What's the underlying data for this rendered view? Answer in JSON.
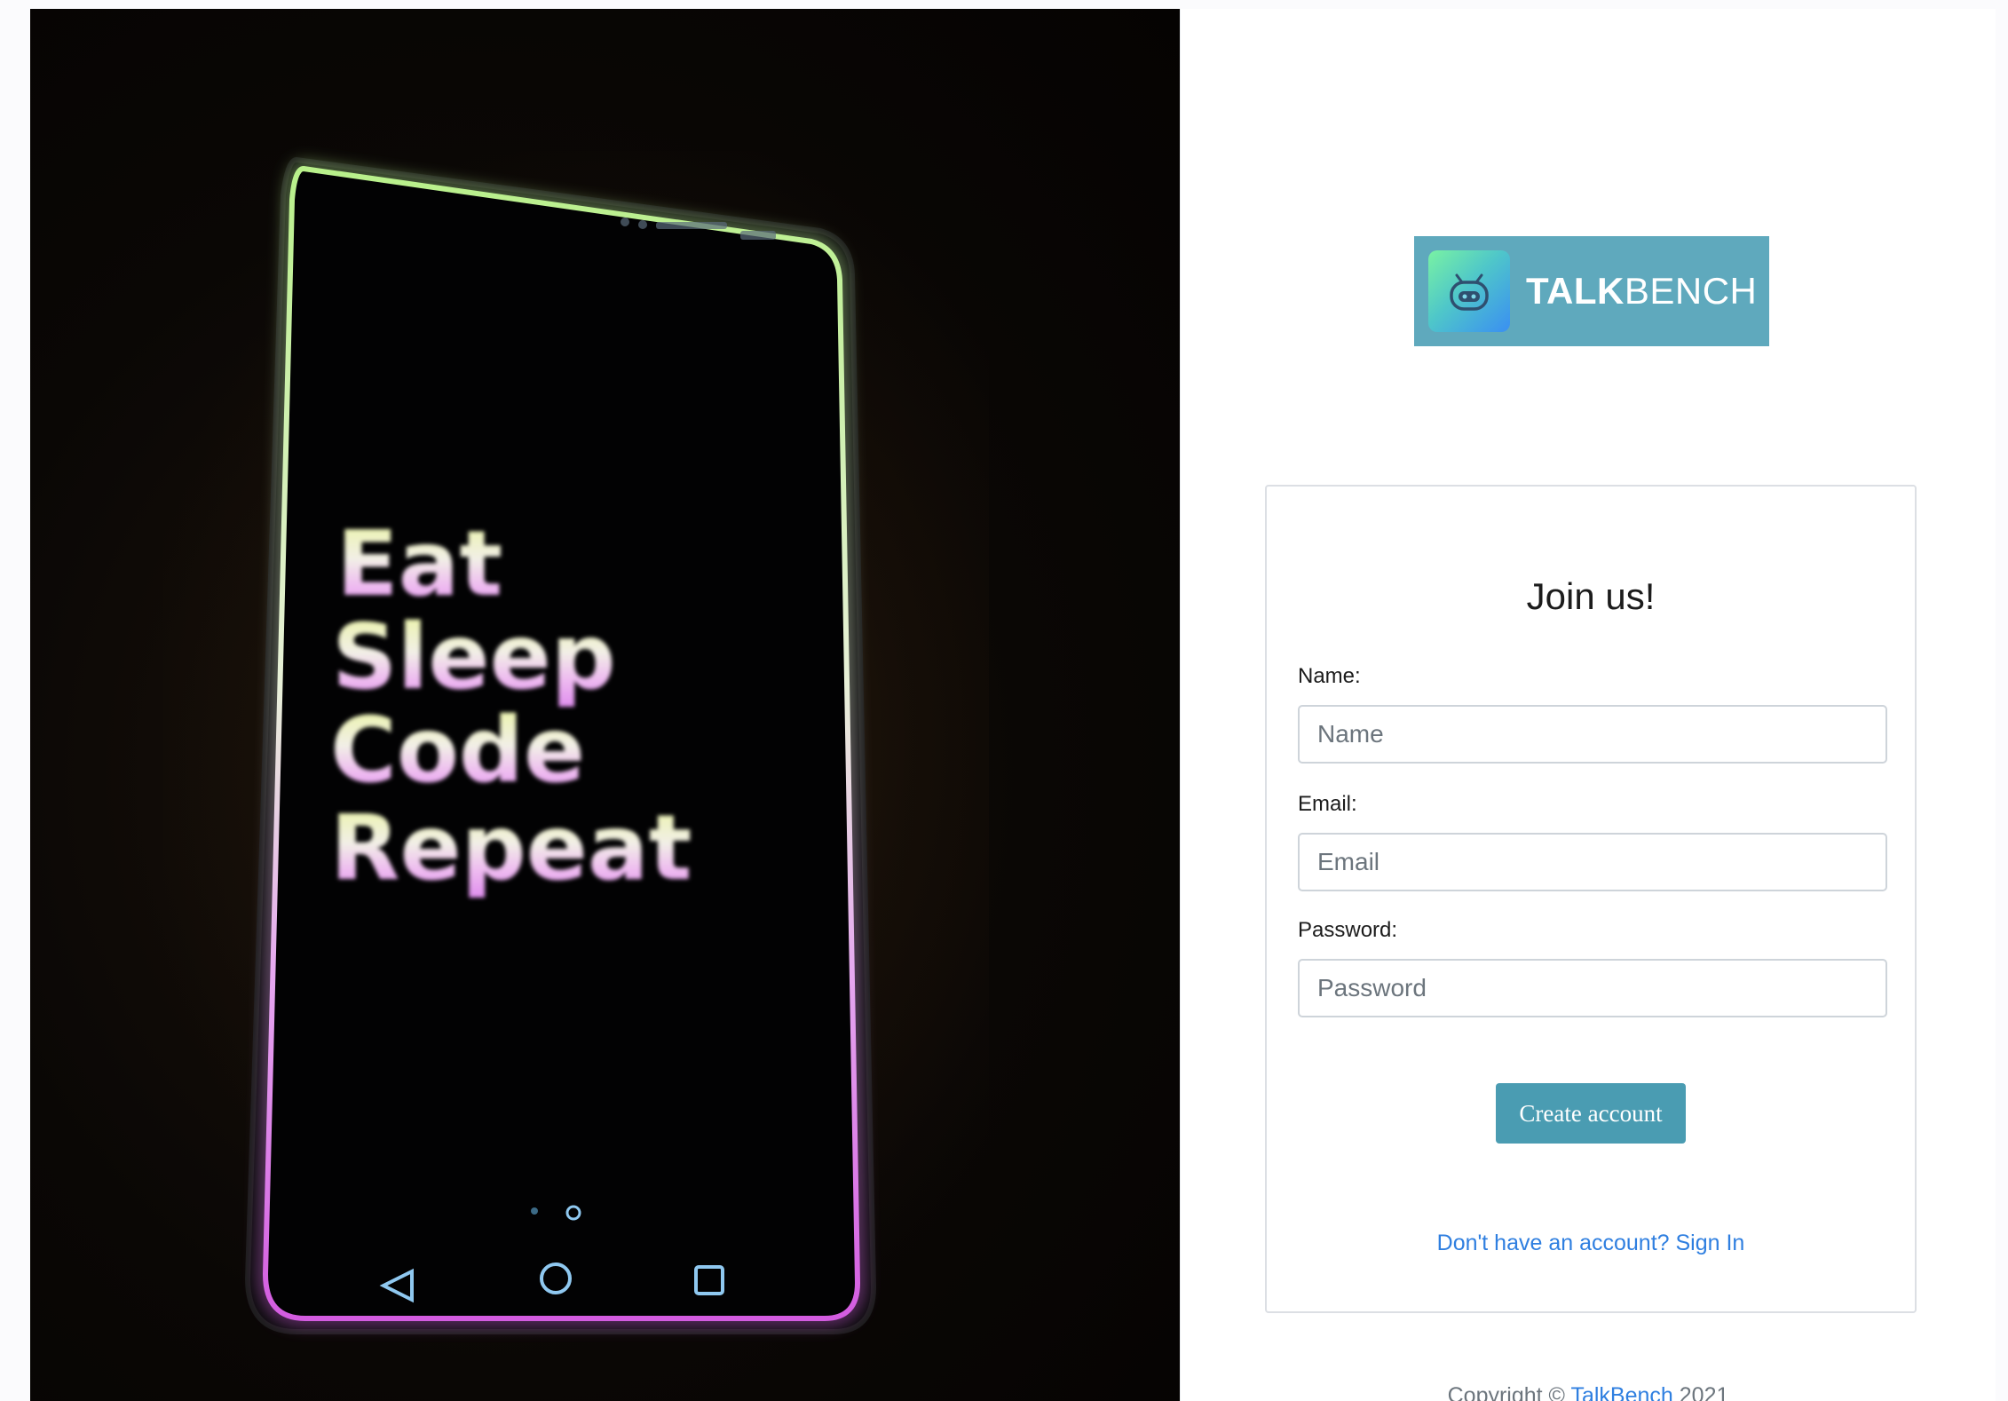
{
  "hero": {
    "phone_text": [
      "Eat",
      "Sleep",
      "Code",
      "Repeat"
    ]
  },
  "brand": {
    "name_bold": "TALK",
    "name_light": "BENCH",
    "logo_bg_color": "#5fa9bd",
    "icon": "robot-icon"
  },
  "form": {
    "title": "Join us!",
    "name_label": "Name:",
    "name_placeholder": "Name",
    "email_label": "Email:",
    "email_placeholder": "Email",
    "password_label": "Password:",
    "password_placeholder": "Password",
    "submit_label": "Create account",
    "submit_color": "#4a9cb2",
    "signin_link": "Don't have an account? Sign In",
    "link_color": "#2f7fe0"
  },
  "footer": {
    "copyright_prefix": "Copyright © ",
    "brand_link": "TalkBench",
    "year": " 2021"
  }
}
